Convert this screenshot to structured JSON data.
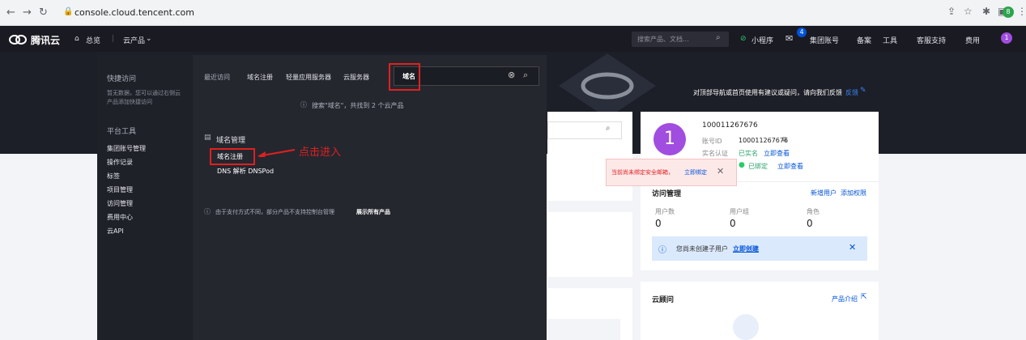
{
  "browser": {
    "url": "console.cloud.tencent.com",
    "ext_label": "8"
  },
  "topnav": {
    "brand": "腾讯云",
    "home": "总览",
    "products": "云产品",
    "search_placeholder": "搜索产品、文档...",
    "mini_program": "小程序",
    "mail_badge": "4",
    "group_account": "集团账号",
    "icp": "备案",
    "tools": "工具",
    "support": "客服支持",
    "billing": "费用",
    "avatar_label": "1"
  },
  "banner": {
    "feedback": "对顶部导航或首页使用有建议或疑问，请向我们反馈",
    "feedback_link": "反馈"
  },
  "menu": {
    "quick_access_title": "快捷访问",
    "quick_access_desc": "暂无数据，您可以通过右侧云产品添加快捷访问",
    "platform_tools_title": "平台工具",
    "tools": [
      "集团账号管理",
      "操作记录",
      "标签",
      "项目管理",
      "访问管理",
      "费用中心",
      "云API"
    ],
    "tabs": [
      "最近访问",
      "域名注册",
      "轻量应用服务器",
      "云服务器"
    ],
    "search_value": "域名",
    "result_info": "搜索\"域名\"，共找到 2 个云产品",
    "group_title": "域名管理",
    "results": [
      "域名注册",
      "DNS 解析 DNSPod"
    ],
    "annotation": "点击进入",
    "footer_note": "由于支付方式不同，部分产品不支持控制台管理",
    "footer_link": "展示所有产品"
  },
  "account": {
    "avatar": "1",
    "name": "100011267676",
    "id_label": "账号ID",
    "id": "100011267676",
    "verify_label": "实名认证",
    "verify_status": "已实名",
    "verify_link": "立即查看",
    "wechat_status": "已绑定",
    "wechat_link": "立即查看"
  },
  "toast": {
    "text": "当前尚未绑定安全邮箱，",
    "link": "立即绑定"
  },
  "access": {
    "title": "访问管理",
    "new_user": "新增用户",
    "add_perm": "添加权限",
    "stats": [
      {
        "label": "用户数",
        "value": "0"
      },
      {
        "label": "用户组",
        "value": "0"
      },
      {
        "label": "角色",
        "value": "0"
      }
    ],
    "notice": "您尚未创建子用户",
    "notice_link": "立即创建"
  },
  "advisor": {
    "title": "云顾问",
    "link": "产品介绍"
  }
}
